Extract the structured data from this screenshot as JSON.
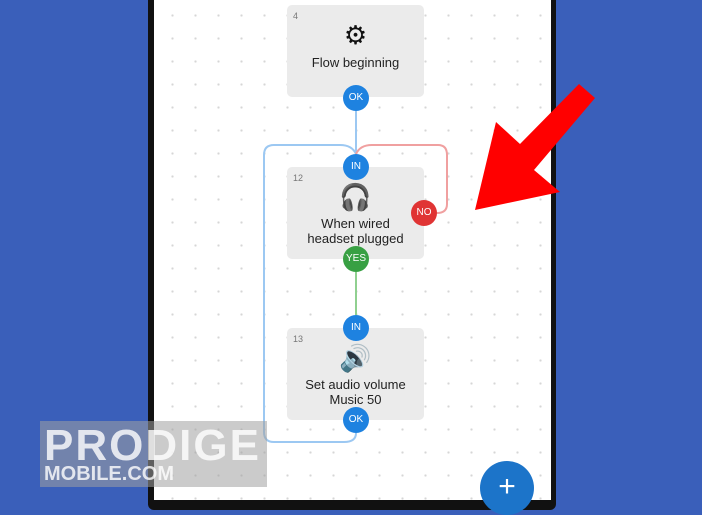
{
  "nodes": [
    {
      "id": "4",
      "label": "Flow beginning",
      "icon": "gear-icon",
      "ports": [
        "OK"
      ]
    },
    {
      "id": "12",
      "label_line1": "When wired",
      "label_line2": "headset plugged",
      "icon": "headset-icon",
      "ports": [
        "IN",
        "NO",
        "YES"
      ]
    },
    {
      "id": "13",
      "label_line1": "Set audio volume",
      "label_line2": "Music 50",
      "icon": "speaker-icon",
      "ports": [
        "IN",
        "OK"
      ]
    }
  ],
  "fab": {
    "label": "+"
  },
  "watermark": {
    "line1": "PRODIGE",
    "line2": "MOBILE.COM"
  },
  "colors": {
    "background": "#3a5fba",
    "port_blue": "#1e82e0",
    "port_red": "#e03434",
    "port_green": "#38a043",
    "arrow": "#ff0000"
  }
}
